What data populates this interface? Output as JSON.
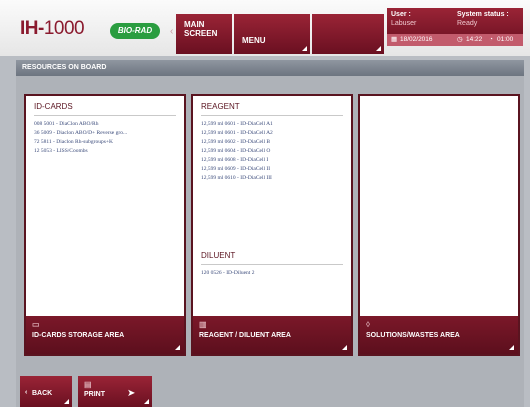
{
  "header": {
    "brand_bold": "IH-",
    "brand_thin": "1000",
    "logo_text": "BIO-RAD",
    "main_screen_line1": "MAIN",
    "main_screen_line2": "SCREEN",
    "menu_label": "MENU",
    "user_label": "User :",
    "user_value": "Labuser",
    "status_label": "System status :",
    "status_value": "Ready",
    "date": "18/02/2016",
    "time": "14:22",
    "counter": "01:00"
  },
  "section": {
    "title": "RESOURCES ON BOARD"
  },
  "panels": {
    "idcards": {
      "title": "ID-CARDS",
      "footer": "ID-CARDS STORAGE AREA",
      "rows": [
        "008  5001 - DiaClon ABO/Rh",
        "36   5009 - Diaclon ABO/D+ Reverse gro...",
        "72   5811 - Diaclon Rh-subgroups+K",
        "12   5053 - LISS/Coombs"
      ]
    },
    "reagent": {
      "title": "REAGENT",
      "footer": "REAGENT / DILUENT AREA",
      "rows": [
        "12,599 ml   0601 - ID-DiaCell A1",
        "12,599 ml   0601 - ID-DiaCell A2",
        "12,599 ml   0602 - ID-DiaCell B",
        "12,599 ml   0604 - ID-DiaCell O",
        "12,599 ml   0608 - ID-DiaCell I",
        "12,599 ml   0609 - ID-DiaCell II",
        "12,599 ml   0610 - ID-DiaCell III"
      ],
      "diluent_title": "DILUENT",
      "diluent_rows": [
        "120   0526 - ID-Diluent 2"
      ]
    },
    "solutions": {
      "footer": "SOLUTIONS/WASTES AREA"
    }
  },
  "bottom": {
    "back_label": "BACK",
    "print_label": "PRINT"
  },
  "colors": {
    "primary": "#7b1829",
    "logo_green": "#2a9d40",
    "background": "#b9bdc3"
  }
}
